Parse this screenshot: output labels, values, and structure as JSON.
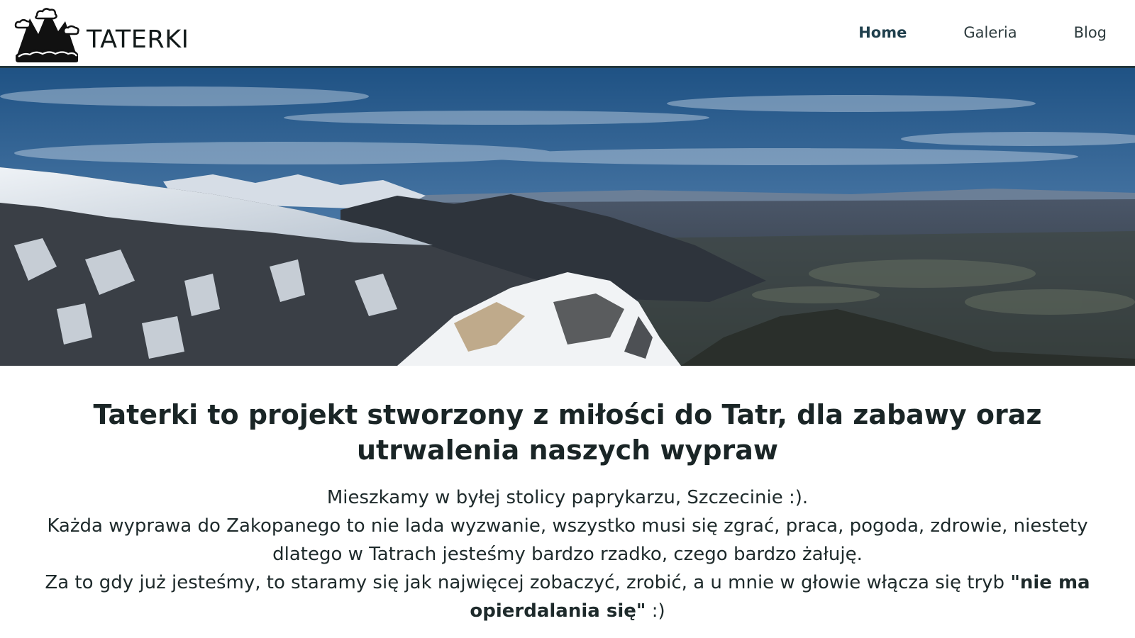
{
  "brand": {
    "name": "TATERKI",
    "logo_icon": "mountains-clouds-icon"
  },
  "nav": {
    "items": [
      {
        "label": "Home",
        "active": true
      },
      {
        "label": "Galeria",
        "active": false
      },
      {
        "label": "Blog",
        "active": false
      }
    ]
  },
  "hero": {
    "image": "tatra-mountains-panorama"
  },
  "main": {
    "headline": "Taterki to projekt stworzony z miłości do Tatr, dla zabawy oraz utrwalenia naszych wypraw",
    "paragraph_1": "Mieszkamy w byłej stolicy paprykarzu, Szczecinie :).",
    "paragraph_2": "Każda wyprawa do Zakopanego to nie lada wyzwanie, wszystko musi się zgrać, praca, pogoda, zdrowie, niestety dlatego w Tatrach jesteśmy bardzo rzadko, czego bardzo żałuję.",
    "paragraph_3_start": "Za to gdy już jesteśmy, to staramy się jak najwięcej zobaczyć, zrobić, a u mnie w głowie włącza się tryb ",
    "paragraph_3_bold": "\"nie ma opierdalania się\"",
    "paragraph_3_end": " :)"
  },
  "colors": {
    "header_border": "#22373d",
    "nav_active": "#1f3f4c",
    "text": "#1b2a2a"
  }
}
